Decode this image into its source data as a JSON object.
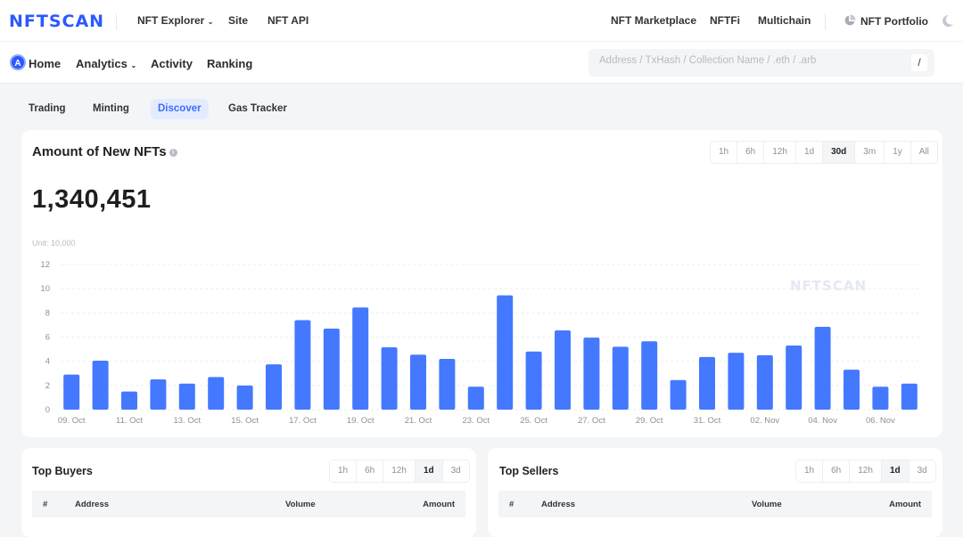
{
  "header": {
    "logo": "NFTSCAN",
    "nav_left": [
      "NFT Explorer",
      "Site",
      "NFT API"
    ],
    "nav_right": [
      "NFT Marketplace",
      "NFTFi",
      "Multichain"
    ],
    "portfolio": "NFT Portfolio",
    "dark_mode_icon": "moon-icon",
    "portfolio_icon": "pie-chart-icon"
  },
  "subnav": {
    "chain_icon": "arbitrum-icon",
    "items": [
      "Home",
      "Analytics",
      "Activity",
      "Ranking"
    ],
    "search_placeholder": "Address / TxHash / Collection Name / .eth / .arb",
    "search_shortcut": "/"
  },
  "tabs": {
    "items": [
      "Trading",
      "Minting",
      "Discover",
      "Gas Tracker"
    ],
    "active": "Discover"
  },
  "main_card": {
    "title": "Amount of New NFTs",
    "info_glyph": "i",
    "total": "1,340,451",
    "unit": "Unit: 10,000",
    "ranges": [
      "1h",
      "6h",
      "12h",
      "1d",
      "30d",
      "3m",
      "1y",
      "All"
    ],
    "active_range": "30d",
    "watermark": "NFTSCAN"
  },
  "chart_data": {
    "type": "bar",
    "title": "Amount of New NFTs",
    "ylabel": "Unit: 10,000",
    "xlabel": "",
    "ylim": [
      0,
      12
    ],
    "yticks": [
      0,
      2,
      4,
      6,
      8,
      10,
      12
    ],
    "grid": true,
    "color": "#4479ff",
    "categories": [
      "09. Oct",
      "10. Oct",
      "11. Oct",
      "12. Oct",
      "13. Oct",
      "14. Oct",
      "15. Oct",
      "16. Oct",
      "17. Oct",
      "18. Oct",
      "19. Oct",
      "20. Oct",
      "21. Oct",
      "22. Oct",
      "23. Oct",
      "24. Oct",
      "25. Oct",
      "26. Oct",
      "27. Oct",
      "28. Oct",
      "29. Oct",
      "30. Oct",
      "31. Oct",
      "01. Nov",
      "02. Nov",
      "03. Nov",
      "04. Nov",
      "05. Nov",
      "06. Nov",
      "07. Nov"
    ],
    "xtick_labels": [
      "09. Oct",
      "11. Oct",
      "13. Oct",
      "15. Oct",
      "17. Oct",
      "19. Oct",
      "21. Oct",
      "23. Oct",
      "25. Oct",
      "27. Oct",
      "29. Oct",
      "31. Oct",
      "02. Nov",
      "04. Nov",
      "06. Nov"
    ],
    "values": [
      2.9,
      4.05,
      1.5,
      2.5,
      2.15,
      2.7,
      2.0,
      3.75,
      7.4,
      6.7,
      8.45,
      5.15,
      4.55,
      4.2,
      1.9,
      9.45,
      4.8,
      6.55,
      5.95,
      5.2,
      5.65,
      2.45,
      4.35,
      4.7,
      4.5,
      5.3,
      6.85,
      3.3,
      1.9,
      2.15
    ]
  },
  "top_buyers": {
    "title": "Top Buyers",
    "ranges": [
      "1h",
      "6h",
      "12h",
      "1d",
      "3d"
    ],
    "active_range": "1d",
    "columns": [
      "#",
      "Address",
      "Volume",
      "Amount"
    ]
  },
  "top_sellers": {
    "title": "Top Sellers",
    "ranges": [
      "1h",
      "6h",
      "12h",
      "1d",
      "3d"
    ],
    "active_range": "1d",
    "columns": [
      "#",
      "Address",
      "Volume",
      "Amount"
    ]
  }
}
